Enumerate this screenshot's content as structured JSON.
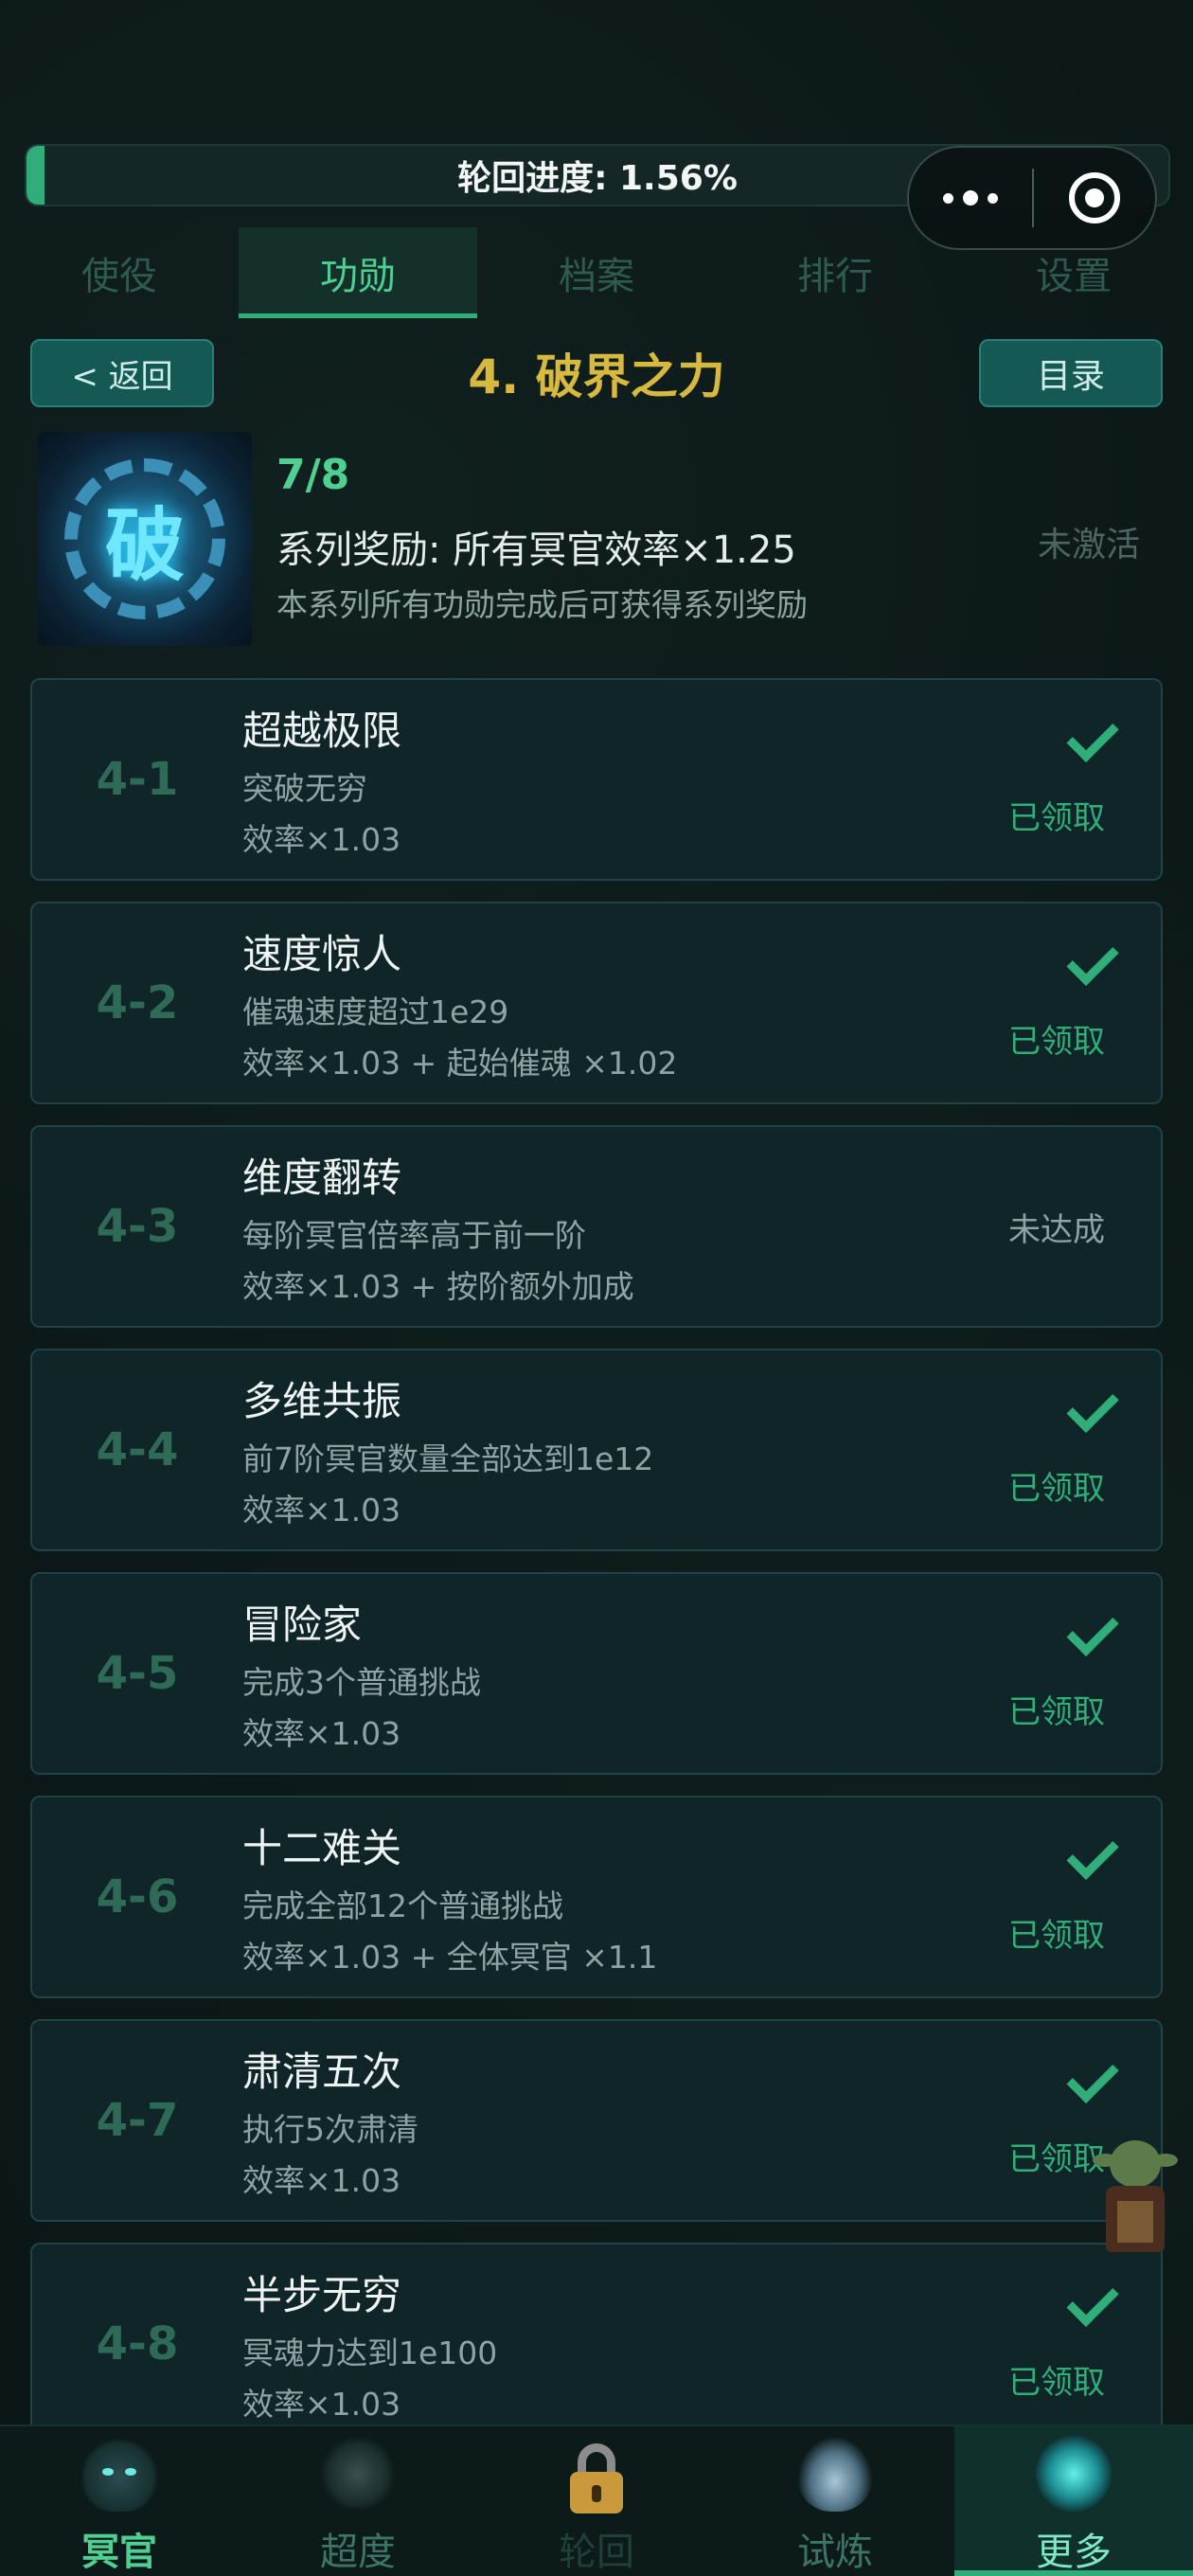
{
  "progress": {
    "label": "轮回进度: 1.56%",
    "value": 1.56
  },
  "tabs": [
    {
      "label": "使役",
      "active": false
    },
    {
      "label": "功勋",
      "active": true
    },
    {
      "label": "档案",
      "active": false
    },
    {
      "label": "排行",
      "active": false
    },
    {
      "label": "设置",
      "active": false
    }
  ],
  "header": {
    "back_label": "< 返回",
    "title": "4. 破界之力",
    "catalog_label": "目录"
  },
  "series": {
    "emblem_glyph": "破",
    "count": "7/8",
    "reward": "系列奖励: 所有冥官效率×1.25",
    "description": "本系列所有功勋完成后可获得系列奖励",
    "status": "未激活"
  },
  "achievements": [
    {
      "id": "4-1",
      "title": "超越极限",
      "condition": "突破无穷",
      "reward": "效率×1.03",
      "status": "已领取",
      "claimed": true
    },
    {
      "id": "4-2",
      "title": "速度惊人",
      "condition": "催魂速度超过1e29",
      "reward": "效率×1.03 + 起始催魂 ×1.02",
      "status": "已领取",
      "claimed": true
    },
    {
      "id": "4-3",
      "title": "维度翻转",
      "condition": "每阶冥官倍率高于前一阶",
      "reward": "效率×1.03 + 按阶额外加成",
      "status": "未达成",
      "claimed": false
    },
    {
      "id": "4-4",
      "title": "多维共振",
      "condition": "前7阶冥官数量全部达到1e12",
      "reward": "效率×1.03",
      "status": "已领取",
      "claimed": true
    },
    {
      "id": "4-5",
      "title": "冒险家",
      "condition": "完成3个普通挑战",
      "reward": "效率×1.03",
      "status": "已领取",
      "claimed": true
    },
    {
      "id": "4-6",
      "title": "十二难关",
      "condition": "完成全部12个普通挑战",
      "reward": "效率×1.03 + 全体冥官 ×1.1",
      "status": "已领取",
      "claimed": true
    },
    {
      "id": "4-7",
      "title": "肃清五次",
      "condition": "执行5次肃清",
      "reward": "效率×1.03",
      "status": "已领取",
      "claimed": true
    },
    {
      "id": "4-8",
      "title": "半步无穷",
      "condition": "冥魂力达到1e100",
      "reward": "效率×1.03",
      "status": "已领取",
      "claimed": true
    }
  ],
  "bottom_nav": [
    {
      "label": "冥官",
      "icon": "guardian-icon"
    },
    {
      "label": "超度",
      "icon": "medal-icon"
    },
    {
      "label": "轮回",
      "icon": "lock-icon"
    },
    {
      "label": "试炼",
      "icon": "flame-icon"
    },
    {
      "label": "更多",
      "icon": "gem-icon"
    }
  ],
  "colors": {
    "accent": "#2fae7a",
    "title_gold": "#d8b940",
    "background": "#0b1616"
  }
}
